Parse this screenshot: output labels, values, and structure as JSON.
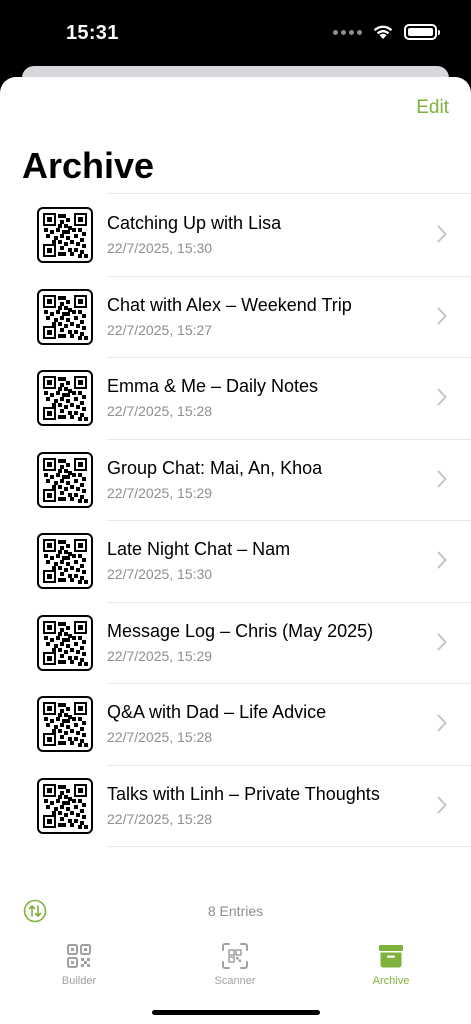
{
  "status_bar": {
    "time": "15:31"
  },
  "header": {
    "edit_label": "Edit",
    "title": "Archive"
  },
  "entries": [
    {
      "title": "Catching Up with Lisa",
      "date": "22/7/2025, 15:30"
    },
    {
      "title": "Chat with Alex – Weekend Trip",
      "date": "22/7/2025, 15:27"
    },
    {
      "title": "Emma & Me – Daily Notes",
      "date": "22/7/2025, 15:28"
    },
    {
      "title": "Group Chat: Mai, An, Khoa",
      "date": "22/7/2025, 15:29"
    },
    {
      "title": "Late Night Chat – Nam",
      "date": "22/7/2025, 15:30"
    },
    {
      "title": "Message Log – Chris (May 2025)",
      "date": "22/7/2025, 15:29"
    },
    {
      "title": "Q&A with Dad – Life Advice",
      "date": "22/7/2025, 15:28"
    },
    {
      "title": "Talks with Linh – Private Thoughts",
      "date": "22/7/2025, 15:28"
    }
  ],
  "footer": {
    "entries_count": "8 Entries"
  },
  "tabs": [
    {
      "label": "Builder",
      "icon": "qr-grid-icon",
      "active": false
    },
    {
      "label": "Scanner",
      "icon": "qr-scan-icon",
      "active": false
    },
    {
      "label": "Archive",
      "icon": "archive-box-icon",
      "active": true
    }
  ],
  "colors": {
    "accent": "#7fb23b",
    "secondary_text": "#8e8e93",
    "separator": "#e5e5ea"
  }
}
